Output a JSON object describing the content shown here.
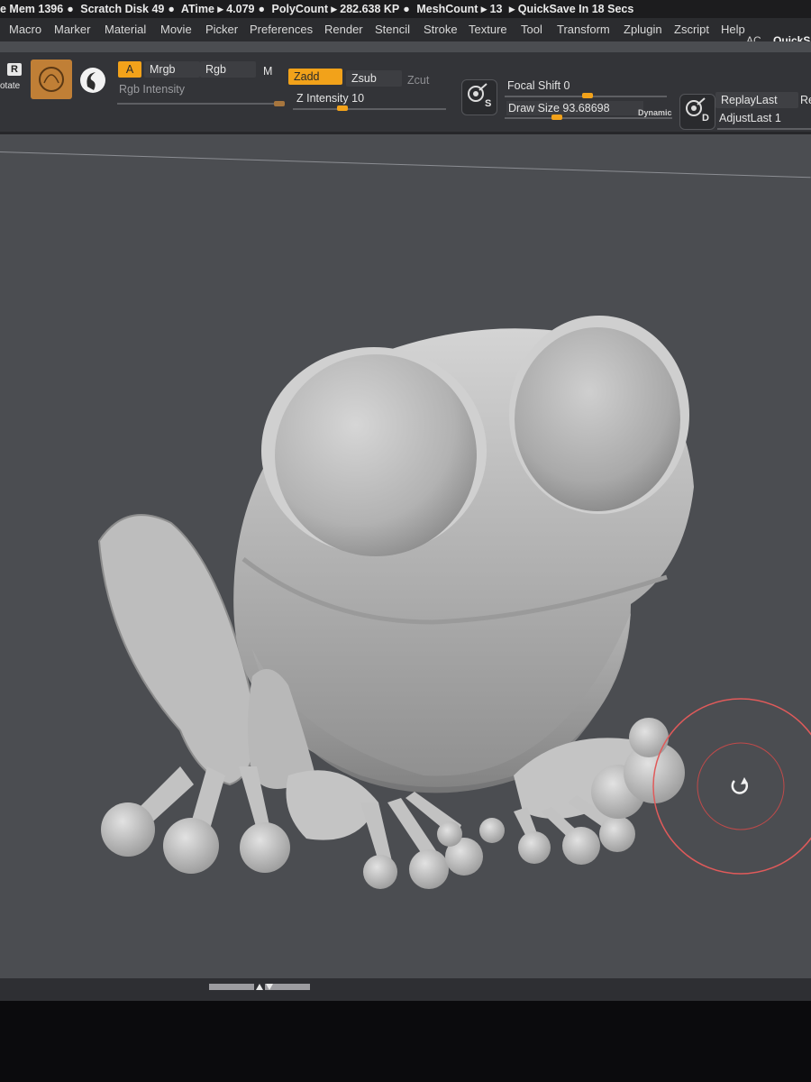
{
  "status_bar": {
    "mem": "e Mem 1396",
    "scratch": "Scratch Disk 49",
    "atime": "ATime ▸ 4.079",
    "polycount": "PolyCount ▸ 282.638 KP",
    "meshcount": "MeshCount ▸ 13",
    "quicksave": "▸ QuickSave In 18 Secs"
  },
  "menu": {
    "items": [
      "Macro",
      "Marker",
      "Material",
      "Movie",
      "Picker",
      "Preferences",
      "Render",
      "Stencil",
      "Stroke",
      "Texture",
      "Tool",
      "Transform",
      "Zplugin",
      "Zscript",
      "Help"
    ],
    "right_ac": "AC",
    "right_quicksave": "QuickSa"
  },
  "toolbar": {
    "rotate_label": "otate",
    "rotate_key": "R",
    "a_label": "A",
    "mrgb_label": "Mrgb",
    "rgb_label": "Rgb",
    "m_label": "M",
    "rgb_intensity_label": "Rgb Intensity",
    "zadd_label": "Zadd",
    "zsub_label": "Zsub",
    "zcut_label": "Zcut",
    "z_intensity_label": "Z Intensity 10",
    "focal_shift_label": "Focal Shift 0",
    "draw_size_label": "Draw Size 93.68698",
    "dynamic_label": "Dynamic",
    "replay_last_label": "ReplayLast",
    "adjust_last_label": "AdjustLast 1",
    "re_label": "Re",
    "s_badge": "S",
    "d_badge": "D"
  },
  "colors": {
    "accent": "#f2a21a",
    "canvas": "#4b4d51",
    "cursor_ring": "#e05a5a",
    "model": "#c9c9c9"
  }
}
